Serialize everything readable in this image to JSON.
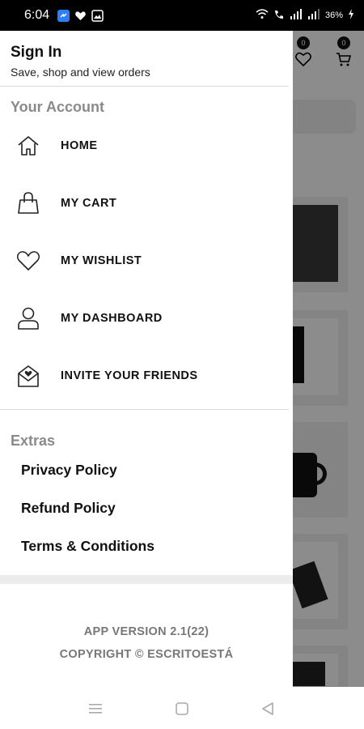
{
  "status_bar": {
    "time": "6:04",
    "battery": "36%",
    "icons": [
      "messenger-icon",
      "heart-icon",
      "gallery-icon"
    ]
  },
  "background": {
    "wishlist_count": "0",
    "cart_count": "0"
  },
  "drawer": {
    "sign_in_title": "Sign In",
    "sign_in_subtitle": "Save, shop and view orders",
    "account_section": "Your Account",
    "menu": [
      {
        "label": "HOME",
        "icon": "home-icon"
      },
      {
        "label": "MY CART",
        "icon": "bag-icon"
      },
      {
        "label": "MY WISHLIST",
        "icon": "heart-icon"
      },
      {
        "label": "MY DASHBOARD",
        "icon": "user-icon"
      },
      {
        "label": "INVITE YOUR FRIENDS",
        "icon": "mail-icon"
      }
    ],
    "extras_section": "Extras",
    "extras": [
      "Privacy Policy",
      "Refund Policy",
      "Terms & Conditions"
    ],
    "app_version": "APP VERSION 2.1(22)",
    "copyright": "COPYRIGHT © ESCRITOESTÁ"
  }
}
